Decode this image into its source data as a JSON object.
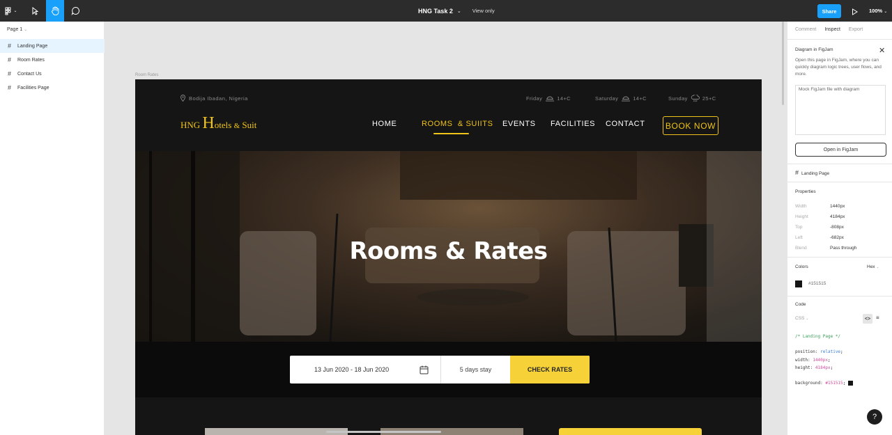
{
  "toolbar": {
    "title": "HNG Task 2",
    "view_mode": "View only",
    "share_label": "Share",
    "zoom": "100%",
    "tools": [
      "figma-menu-icon",
      "move-icon",
      "hand-icon",
      "comment-icon"
    ]
  },
  "left_panel": {
    "page_select": "Page 1",
    "layers": [
      {
        "label": "Landing Page",
        "selected": true
      },
      {
        "label": "Room Rates",
        "selected": false
      },
      {
        "label": "Contact Us",
        "selected": false
      },
      {
        "label": "Facilities Page",
        "selected": false
      }
    ]
  },
  "canvas": {
    "frame_label": "Room Rates",
    "site": {
      "location": "Bodija Ibadan, Nigeria",
      "weather": [
        {
          "day": "Friday",
          "temp": "14+C"
        },
        {
          "day": "Saturday",
          "temp": "14+C"
        },
        {
          "day": "Sunday",
          "temp": "25+C"
        }
      ],
      "logo": {
        "part1": "HNG ",
        "big": "H",
        "part2": "otels ",
        "amp": "&",
        "part3": " Suit"
      },
      "nav": [
        {
          "label": "HOME",
          "active": false
        },
        {
          "label": "ROOMS  & SUIITS",
          "active": true
        },
        {
          "label": "EVENTS",
          "active": false
        },
        {
          "label": "FACILITIES",
          "active": false
        },
        {
          "label": "CONTACT",
          "active": false
        }
      ],
      "book_now": "BOOK NOW",
      "hero_title": "Rooms & Rates",
      "booking": {
        "dates": "13 Jun 2020 - 18 Jun 2020",
        "stay": "5 days stay",
        "check": "CHECK RATES"
      }
    }
  },
  "right_panel": {
    "tabs": [
      "Comment",
      "Inspect",
      "Export"
    ],
    "active_tab": "Inspect",
    "figjam_title": "Diagram in FigJam",
    "figjam_desc": "Open this page in FigJam, where you can quickly diagram logic trees, user flows, and more.",
    "figjam_img_alt": "Mock FigJam file with diagram",
    "figjam_button": "Open in FigJam",
    "selection": "Landing Page",
    "properties_title": "Properties",
    "properties": [
      {
        "k": "Width",
        "v": "1440px"
      },
      {
        "k": "Height",
        "v": "4184px"
      },
      {
        "k": "Top",
        "v": "-808px"
      },
      {
        "k": "Left",
        "v": "-682px"
      },
      {
        "k": "Blend",
        "v": "Pass through"
      }
    ],
    "colors_title": "Colors",
    "color_format": "Hex",
    "color_value": "#151515",
    "code_title": "Code",
    "code_lang": "CSS",
    "code": {
      "comment": "/* Landing Page */",
      "position_k": "position:",
      "position_v": "relative",
      "width_k": "width:",
      "width_v": "1440px",
      "height_k": "height:",
      "height_v": "4184px",
      "bg_k": "background:",
      "bg_v": "#151515"
    },
    "help": "?"
  },
  "colors": {
    "accent": "#18a0fb",
    "brand_yellow": "#f0c419",
    "frame_bg": "#151515"
  }
}
